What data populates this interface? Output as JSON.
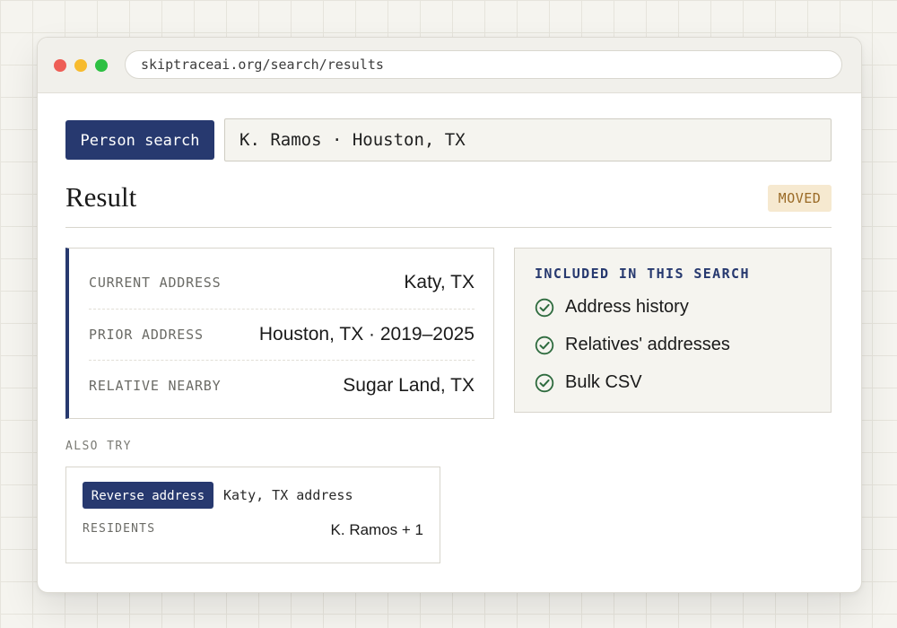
{
  "browser": {
    "url": "skiptraceai.org/search/results"
  },
  "search": {
    "mode_label": "Person search",
    "query": "K. Ramos · Houston, TX"
  },
  "result": {
    "title": "Result",
    "status_badge": "MOVED",
    "addresses": [
      {
        "label": "CURRENT ADDRESS",
        "value": "Katy, TX"
      },
      {
        "label": "PRIOR ADDRESS",
        "value": "Houston, TX · 2019–2025"
      },
      {
        "label": "RELATIVE NEARBY",
        "value": "Sugar Land, TX"
      }
    ]
  },
  "included": {
    "heading": "INCLUDED IN THIS SEARCH",
    "icon": "check-circle-icon",
    "items": [
      "Address history",
      "Relatives' addresses",
      "Bulk CSV"
    ]
  },
  "also_try": {
    "heading": "ALSO TRY",
    "button_label": "Reverse address",
    "query": "Katy, TX address",
    "residents_label": "RESIDENTS",
    "residents_value": "K. Ramos + 1"
  },
  "colors": {
    "accent": "#27396f",
    "badge_bg": "#f6e9d0",
    "badge_text": "#9a6a26",
    "check": "#2e6b3e",
    "window_controls": [
      "#ee5e56",
      "#f7bb2e",
      "#2dc042"
    ]
  }
}
